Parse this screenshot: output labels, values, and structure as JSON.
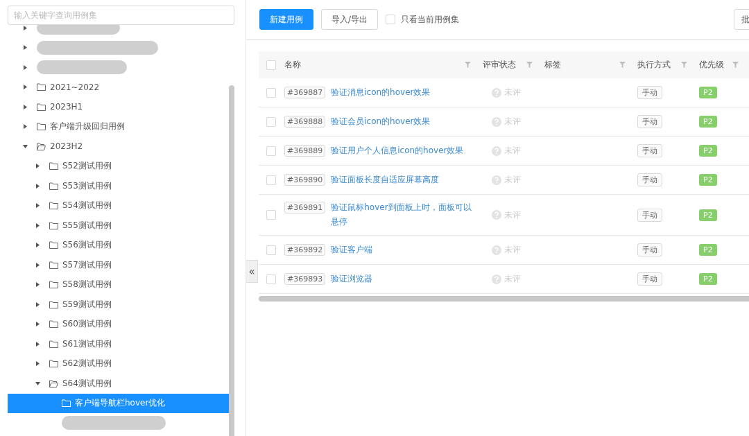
{
  "sidebar": {
    "search": {
      "placeholder": "输入关键字查询用例集"
    },
    "tree": [
      {
        "kind": "redacted",
        "expanded": false
      },
      {
        "kind": "redacted",
        "expanded": false
      },
      {
        "kind": "redacted",
        "expanded": false
      },
      {
        "kind": "folder",
        "label": "2021~2022",
        "expanded": false,
        "selected": false
      },
      {
        "kind": "folder",
        "label": "2023H1",
        "expanded": false,
        "selected": false
      },
      {
        "kind": "folder",
        "label": "客户端升级回归用例",
        "expanded": false,
        "selected": false
      },
      {
        "kind": "folder",
        "label": "2023H2",
        "expanded": true,
        "selected": false,
        "children": [
          {
            "kind": "folder",
            "label": "S52测试用例",
            "expanded": false,
            "selected": false
          },
          {
            "kind": "folder",
            "label": "S53测试用例",
            "expanded": false,
            "selected": false
          },
          {
            "kind": "folder",
            "label": "S54测试用例",
            "expanded": false,
            "selected": false
          },
          {
            "kind": "folder",
            "label": "S55测试用例",
            "expanded": false,
            "selected": false
          },
          {
            "kind": "folder",
            "label": "S56测试用例",
            "expanded": false,
            "selected": false
          },
          {
            "kind": "folder",
            "label": "S57测试用例",
            "expanded": false,
            "selected": false
          },
          {
            "kind": "folder",
            "label": "S58测试用例",
            "expanded": false,
            "selected": false
          },
          {
            "kind": "folder",
            "label": "S59测试用例",
            "expanded": false,
            "selected": false
          },
          {
            "kind": "folder",
            "label": "S60测试用例",
            "expanded": false,
            "selected": false
          },
          {
            "kind": "folder",
            "label": "S61测试用例",
            "expanded": false,
            "selected": false
          },
          {
            "kind": "folder",
            "label": "S62测试用例",
            "expanded": false,
            "selected": false
          },
          {
            "kind": "folder",
            "label": "S64测试用例",
            "expanded": true,
            "selected": false,
            "children": [
              {
                "kind": "leaf",
                "label": "客户端导航栏hover优化",
                "selected": true
              },
              {
                "kind": "redacted"
              }
            ]
          }
        ]
      }
    ]
  },
  "collapse_button": {
    "label": "«"
  },
  "toolbar": {
    "buttons": [
      {
        "label": "新建用例",
        "kind": "primary"
      },
      {
        "label": "导入/导出",
        "kind": "default"
      }
    ],
    "filter_checkbox": {
      "label": "只看当前用例集",
      "checked": false
    },
    "right_button": {
      "label": "批"
    }
  },
  "table": {
    "select_all": {
      "checked": false
    },
    "columns": [
      "名称",
      "评审状态",
      "标签",
      "执行方式",
      "优先级"
    ],
    "rows": [
      {
        "checked": false,
        "id": "#369887",
        "name": "验证消息icon的hover效果",
        "review": "未评",
        "execution": "手动",
        "priority": "P2"
      },
      {
        "checked": false,
        "id": "#369888",
        "name": "验证会员icon的hover效果",
        "review": "未评",
        "execution": "手动",
        "priority": "P2"
      },
      {
        "checked": false,
        "id": "#369889",
        "name": "验证用户个人信息icon的hover效果",
        "review": "未评",
        "execution": "手动",
        "priority": "P2"
      },
      {
        "checked": false,
        "id": "#369890",
        "name": "验证面板长度自适应屏幕高度",
        "review": "未评",
        "execution": "手动",
        "priority": "P2"
      },
      {
        "checked": false,
        "id": "#369891",
        "name": "验证鼠标hover到面板上时，面板可以悬停",
        "review": "未评",
        "execution": "手动",
        "priority": "P2"
      },
      {
        "checked": false,
        "id": "#369892",
        "name": "验证客户端",
        "review": "未评",
        "execution": "手动",
        "priority": "P2"
      },
      {
        "checked": false,
        "id": "#369893",
        "name": "验证浏览器",
        "review": "未评",
        "execution": "手动",
        "priority": "P2"
      }
    ]
  }
}
